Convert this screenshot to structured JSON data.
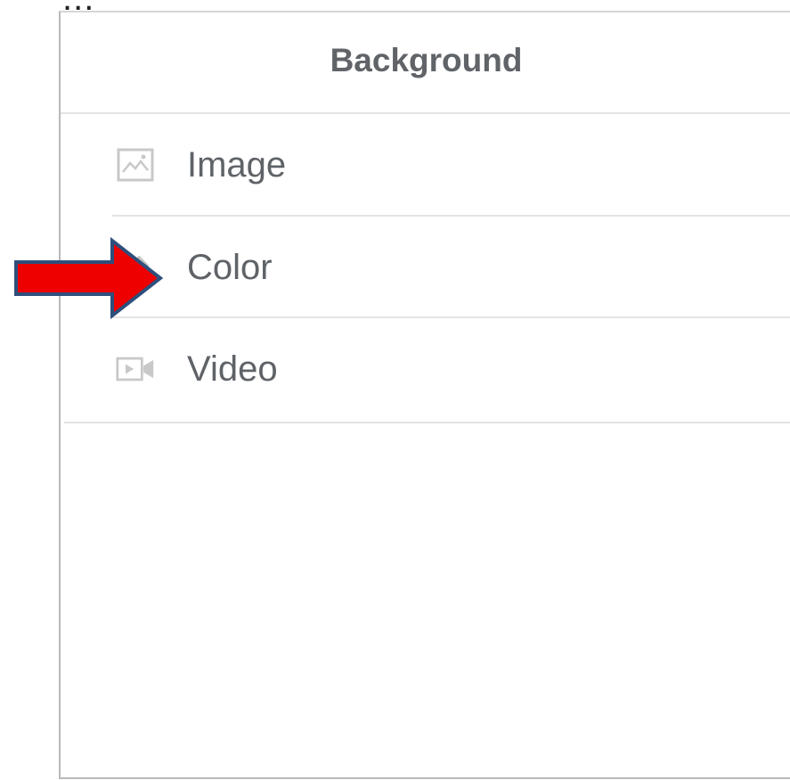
{
  "background_text": "...",
  "panel": {
    "title": "Background",
    "items": [
      {
        "label": "Image",
        "icon": "image-icon"
      },
      {
        "label": "Color",
        "icon": "color-icon"
      },
      {
        "label": "Video",
        "icon": "video-icon"
      }
    ]
  },
  "annotation": {
    "arrow_color": "#ee0000",
    "arrow_outline": "#2e4f7c",
    "points_to": "Color"
  },
  "colors": {
    "text": "#5f6368",
    "divider": "#e3e3e3",
    "icon": "#c8c8c8"
  }
}
